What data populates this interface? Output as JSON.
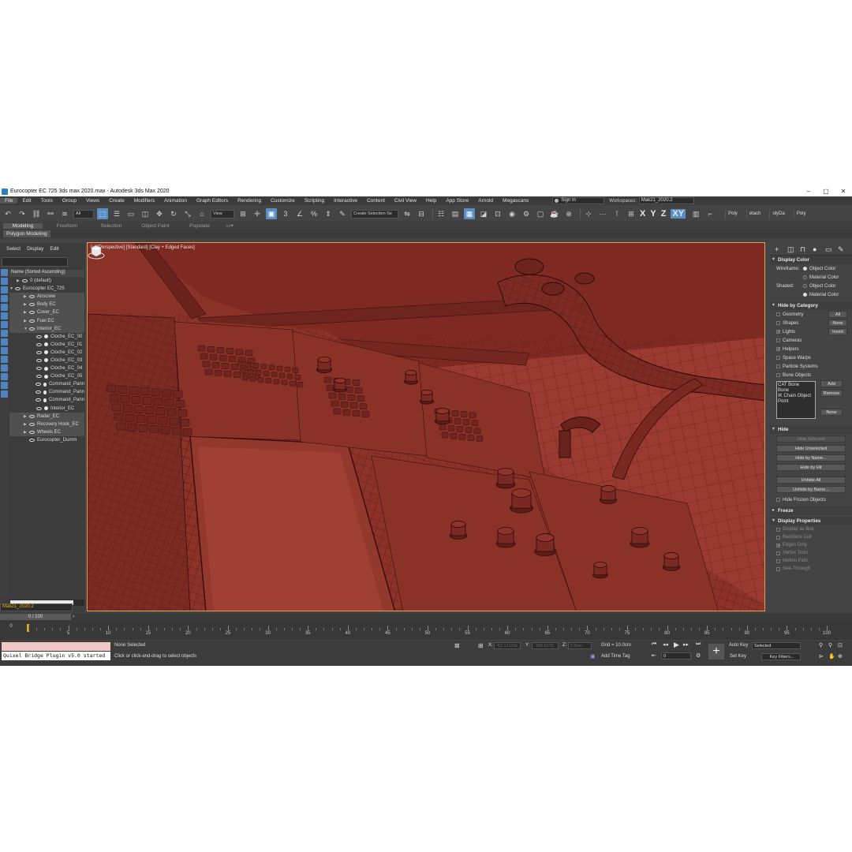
{
  "window": {
    "title": "Eurocopter EC 725 3ds max 2020.max - Autodesk 3ds Max 2020",
    "min": "–",
    "max": "▢",
    "close": "✕"
  },
  "menu": [
    "File",
    "Edit",
    "Tools",
    "Group",
    "Views",
    "Create",
    "Modifiers",
    "Animation",
    "Graph Editors",
    "Rendering",
    "Customize",
    "Scripting",
    "Interactive",
    "Content",
    "Civil View",
    "Help",
    "App Store",
    "Arnold",
    "Megascans"
  ],
  "account": {
    "signin": "Sign In",
    "workspaces_label": "Workspaces:",
    "workspace": "Mak21_2020.2"
  },
  "toolbar": {
    "filter": "All",
    "refcoord": "View",
    "named_selection": "Create Selection Se",
    "axes": [
      "X",
      "Y",
      "Z",
      "XY"
    ],
    "right_tabs": [
      "Poly",
      "etach",
      "olyDa",
      "Poly"
    ]
  },
  "ribbon": {
    "tabs": [
      "Modeling",
      "Freeform",
      "Selection",
      "Object Paint",
      "Populate"
    ],
    "active": "Modeling",
    "sub": "Polygon Modeling"
  },
  "explorer": {
    "menu": [
      "Select",
      "Display",
      "Edit"
    ],
    "header": "Name (Sorted Ascending)",
    "items": [
      {
        "label": "0 (default)",
        "indent": 1,
        "kind": "layer"
      },
      {
        "label": "Eurocopter EC_725",
        "indent": 0,
        "kind": "layer-open"
      },
      {
        "label": "Airscrew",
        "indent": 2,
        "kind": "group"
      },
      {
        "label": "Body EC",
        "indent": 2,
        "kind": "group"
      },
      {
        "label": "Cover_EC",
        "indent": 2,
        "kind": "group"
      },
      {
        "label": "Fuel EC",
        "indent": 2,
        "kind": "group"
      },
      {
        "label": "Interior_EC",
        "indent": 2,
        "kind": "group-open"
      },
      {
        "label": "Cloche_EC_00",
        "indent": 3,
        "kind": "obj"
      },
      {
        "label": "Cloche_EC_01",
        "indent": 3,
        "kind": "obj"
      },
      {
        "label": "Cloche_EC_02",
        "indent": 3,
        "kind": "obj"
      },
      {
        "label": "Cloche_EC_03",
        "indent": 3,
        "kind": "obj"
      },
      {
        "label": "Cloche_EC_04",
        "indent": 3,
        "kind": "obj"
      },
      {
        "label": "Cloche_EC_05",
        "indent": 3,
        "kind": "obj"
      },
      {
        "label": "Command_Pann",
        "indent": 3,
        "kind": "obj"
      },
      {
        "label": "Command_Pann",
        "indent": 3,
        "kind": "obj"
      },
      {
        "label": "Command_Pann",
        "indent": 3,
        "kind": "obj"
      },
      {
        "label": "Interior_EC",
        "indent": 3,
        "kind": "obj"
      },
      {
        "label": "Radar_EC",
        "indent": 2,
        "kind": "group"
      },
      {
        "label": "Recovery Hook_EC",
        "indent": 2,
        "kind": "group"
      },
      {
        "label": "Wheels EC",
        "indent": 2,
        "kind": "group"
      },
      {
        "label": "Eurocopter_Dumm",
        "indent": 2,
        "kind": "dummy"
      }
    ],
    "layer": "Mak21_2020.2"
  },
  "viewport": {
    "label": "[+] [Perspective] [Standard] [Clay + Edged Faces]"
  },
  "command_panel": {
    "display_color": {
      "title": "Display Color",
      "wireframe_label": "Wireframe:",
      "shaded_label": "Shaded:",
      "opt_object": "Object Color",
      "opt_material": "Material Color"
    },
    "hide_by_category": {
      "title": "Hide by Category",
      "items": [
        {
          "label": "Geometry",
          "checked": false
        },
        {
          "label": "Shapes",
          "checked": false
        },
        {
          "label": "Lights",
          "checked": true
        },
        {
          "label": "Cameras",
          "checked": false
        },
        {
          "label": "Helpers",
          "checked": true
        },
        {
          "label": "Space Warps",
          "checked": false
        },
        {
          "label": "Particle Systems",
          "checked": false
        },
        {
          "label": "Bone Objects",
          "checked": false
        }
      ],
      "btn_all": "All",
      "btn_none": "None",
      "btn_invert": "Invert",
      "list": [
        "CAT Bone",
        "Bone",
        "IK Chain Object",
        "Point"
      ],
      "btn_add": "Add",
      "btn_remove": "Remove",
      "btn_none2": "None"
    },
    "hide": {
      "title": "Hide",
      "hide_selected": "Hide Selected",
      "hide_unselected": "Hide Unselected",
      "hide_by_name": "Hide by Name...",
      "hide_by_hit": "Hide by Hit",
      "unhide_all": "Unhide All",
      "unhide_by_name": "Unhide by Name...",
      "hide_frozen": "Hide Frozen Objects"
    },
    "freeze": {
      "title": "Freeze"
    },
    "display_props": {
      "title": "Display Properties",
      "items": [
        {
          "label": "Display as Box",
          "checked": false
        },
        {
          "label": "Backface Cull",
          "checked": false
        },
        {
          "label": "Edges Only",
          "checked": true
        },
        {
          "label": "Vertex Ticks",
          "checked": false
        },
        {
          "label": "Motion Path",
          "checked": false
        },
        {
          "label": "See-Through",
          "checked": false
        }
      ]
    }
  },
  "timeline": {
    "frame_display": "0 / 100",
    "labels": [
      "5",
      "10",
      "15",
      "20",
      "25",
      "30",
      "35",
      "40",
      "45",
      "50",
      "55",
      "60",
      "65",
      "70",
      "75",
      "80",
      "85",
      "90",
      "95",
      "100"
    ],
    "cursor_label": "0"
  },
  "status": {
    "maxscript": "Quixel Bridge Plugin v5.0 started",
    "selection": "None Selected",
    "prompt": "Click or click-and-drag to select objects",
    "x_label": "X:",
    "x_value": "-62.12103c",
    "y_label": "Y:",
    "y_value": "-306.6976",
    "z_label": "Z:",
    "z_value": "0.0cm",
    "grid": "Grid = 10.0cm",
    "add_time_tag": "Add Time Tag",
    "frame": "0",
    "auto_key": "Auto Key",
    "set_key": "Set Key",
    "selected": "Selected",
    "key_filters": "Key Filters..."
  },
  "colors": {
    "accent": "#5a8fc4",
    "viewport_bg": "#7a2a22",
    "viewport_border": "#e0a05a",
    "ui_bg": "#444444"
  }
}
